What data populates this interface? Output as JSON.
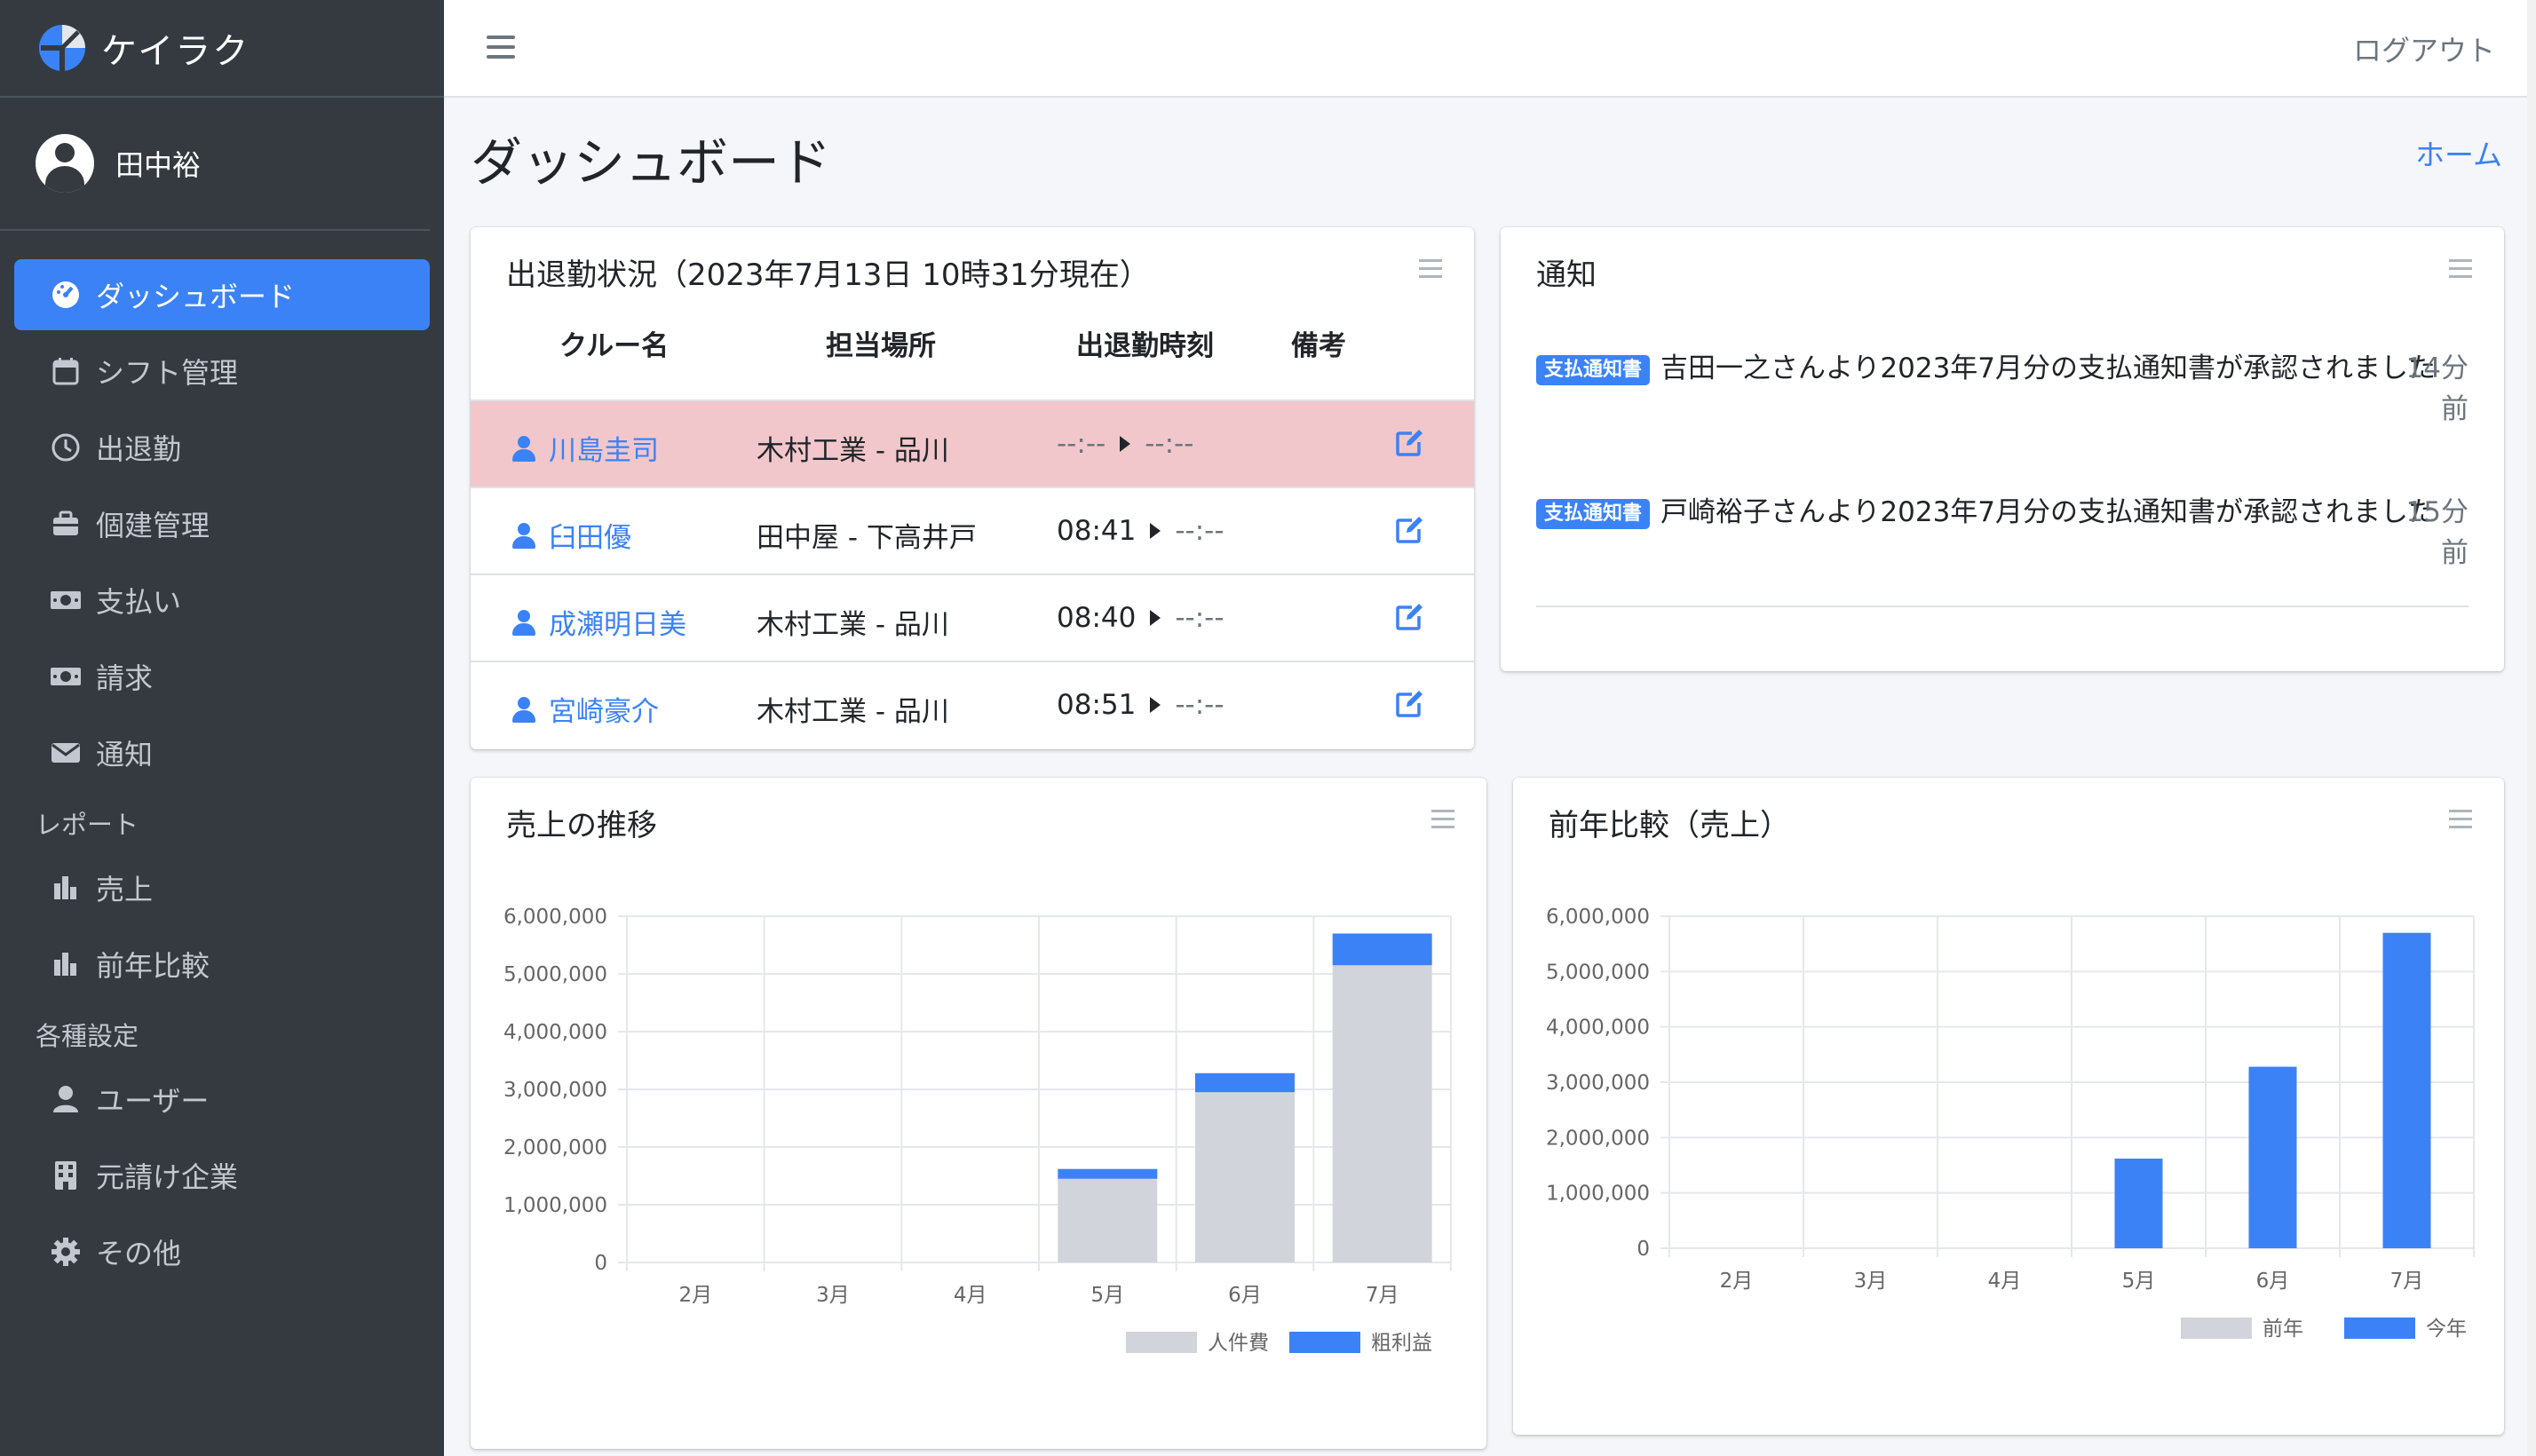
{
  "brand": {
    "name": "ケイラク"
  },
  "user": {
    "name": "田中裕"
  },
  "sidebar": {
    "items": [
      {
        "label": "ダッシュボード",
        "icon": "tachometer-icon",
        "active": true
      },
      {
        "label": "シフト管理",
        "icon": "calendar-icon"
      },
      {
        "label": "出退勤",
        "icon": "clock-icon"
      },
      {
        "label": "個建管理",
        "icon": "toolbox-icon"
      },
      {
        "label": "支払い",
        "icon": "money-icon"
      },
      {
        "label": "請求",
        "icon": "money-icon"
      },
      {
        "label": "通知",
        "icon": "envelope-icon"
      }
    ],
    "report_header": "レポート",
    "report_items": [
      {
        "label": "売上",
        "icon": "bar-chart-icon"
      },
      {
        "label": "前年比較",
        "icon": "bar-chart-icon"
      }
    ],
    "settings_header": "各種設定",
    "settings_items": [
      {
        "label": "ユーザー",
        "icon": "user-icon"
      },
      {
        "label": "元請け企業",
        "icon": "building-icon"
      },
      {
        "label": "その他",
        "icon": "gear-icon"
      }
    ]
  },
  "header": {
    "logout": "ログアウト"
  },
  "page": {
    "title": "ダッシュボード",
    "breadcrumb": "ホーム"
  },
  "attendance": {
    "title": "出退勤状況（2023年7月13日 10時31分現在）",
    "columns": [
      "クルー名",
      "担当場所",
      "出退勤時刻",
      "備考"
    ],
    "rows": [
      {
        "name": "川島圭司",
        "place": "木村工業 - 品川",
        "in": "--:--",
        "out": "--:--",
        "highlight": true
      },
      {
        "name": "臼田優",
        "place": "田中屋 - 下高井戸",
        "in": "08:41",
        "out": "--:--"
      },
      {
        "name": "成瀬明日美",
        "place": "木村工業 - 品川",
        "in": "08:40",
        "out": "--:--"
      },
      {
        "name": "宮崎豪介",
        "place": "木村工業 - 品川",
        "in": "08:51",
        "out": "--:--"
      }
    ]
  },
  "notices": {
    "title": "通知",
    "items": [
      {
        "badge": "支払通知書",
        "text": "吉田一之さんより2023年7月分の支払通知書が承認されました",
        "time": "14分前"
      },
      {
        "badge": "支払通知書",
        "text": "戸崎裕子さんより2023年7月分の支払通知書が承認されました",
        "time": "15分前"
      }
    ]
  },
  "colors": {
    "primary": "#3b82f6",
    "gray_bar": "#d1d5db",
    "sidebar_bg": "#343a40"
  },
  "chart_data": [
    {
      "type": "bar",
      "stacked": true,
      "title": "売上の推移",
      "categories": [
        "2月",
        "3月",
        "4月",
        "5月",
        "6月",
        "7月"
      ],
      "series": [
        {
          "name": "人件費",
          "color": "#d1d5db",
          "values": [
            0,
            0,
            0,
            1450000,
            2950000,
            5150000
          ]
        },
        {
          "name": "粗利益",
          "color": "#3b82f6",
          "values": [
            0,
            0,
            0,
            170000,
            330000,
            550000
          ]
        }
      ],
      "ylim": [
        0,
        6000000
      ],
      "yticks": [
        "6,000,000",
        "5,000,000",
        "4,000,000",
        "3,000,000",
        "2,000,000",
        "1,000,000",
        "0"
      ],
      "legend": "bottom-right"
    },
    {
      "type": "bar",
      "title": "前年比較（売上）",
      "categories": [
        "2月",
        "3月",
        "4月",
        "5月",
        "6月",
        "7月"
      ],
      "series": [
        {
          "name": "前年",
          "color": "#d1d5db",
          "values": [
            0,
            0,
            0,
            0,
            0,
            0
          ]
        },
        {
          "name": "今年",
          "color": "#3b82f6",
          "values": [
            0,
            0,
            0,
            1620000,
            3280000,
            5700000
          ]
        }
      ],
      "ylim": [
        0,
        6000000
      ],
      "yticks": [
        "6,000,000",
        "5,000,000",
        "4,000,000",
        "3,000,000",
        "2,000,000",
        "1,000,000",
        "0"
      ],
      "legend": "bottom-right"
    }
  ]
}
